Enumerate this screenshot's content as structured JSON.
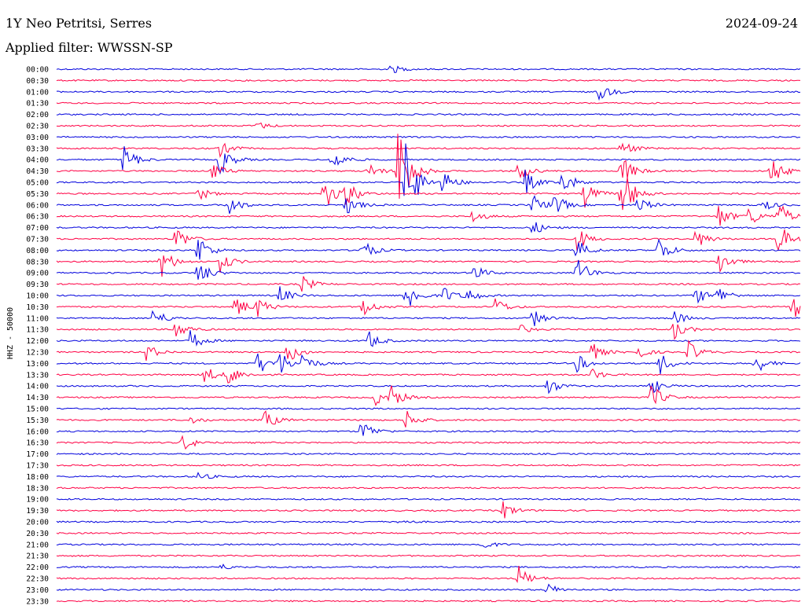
{
  "header": {
    "station": "1Y Neo Petritsi, Serres",
    "date": "2024-09-24",
    "filter": "Applied filter: WWSSN-SP"
  },
  "chart_data": {
    "type": "line",
    "ylabel": "HHZ - 50000",
    "colors": [
      "#0000dd",
      "#ff0044"
    ],
    "rows": [
      {
        "label": "00:00",
        "events": [
          {
            "t": 0.45,
            "a": 6
          }
        ]
      },
      {
        "label": "00:30",
        "events": []
      },
      {
        "label": "01:00",
        "events": [
          {
            "t": 0.73,
            "a": 12
          }
        ]
      },
      {
        "label": "01:30",
        "events": []
      },
      {
        "label": "02:00",
        "events": []
      },
      {
        "label": "02:30",
        "events": [
          {
            "t": 0.27,
            "a": 5
          }
        ]
      },
      {
        "label": "03:00",
        "events": []
      },
      {
        "label": "03:30",
        "events": [
          {
            "t": 0.22,
            "a": 10
          },
          {
            "t": 0.76,
            "a": 12
          }
        ]
      },
      {
        "label": "04:00",
        "events": [
          {
            "t": 0.09,
            "a": 22
          },
          {
            "t": 0.22,
            "a": 20
          },
          {
            "t": 0.37,
            "a": 18
          }
        ]
      },
      {
        "label": "04:30",
        "events": [
          {
            "t": 0.21,
            "a": 12
          },
          {
            "t": 0.42,
            "a": 10
          },
          {
            "t": 0.46,
            "a": 80
          },
          {
            "t": 0.62,
            "a": 14
          },
          {
            "t": 0.76,
            "a": 22
          },
          {
            "t": 0.96,
            "a": 22
          }
        ]
      },
      {
        "label": "05:00",
        "events": [
          {
            "t": 0.47,
            "a": 60
          },
          {
            "t": 0.52,
            "a": 18
          },
          {
            "t": 0.63,
            "a": 16
          },
          {
            "t": 0.68,
            "a": 18
          }
        ]
      },
      {
        "label": "05:30",
        "events": [
          {
            "t": 0.19,
            "a": 10
          },
          {
            "t": 0.36,
            "a": 22
          },
          {
            "t": 0.39,
            "a": 18
          },
          {
            "t": 0.71,
            "a": 18
          },
          {
            "t": 0.76,
            "a": 40
          }
        ]
      },
      {
        "label": "06:00",
        "events": [
          {
            "t": 0.23,
            "a": 16
          },
          {
            "t": 0.39,
            "a": 14
          },
          {
            "t": 0.64,
            "a": 14
          },
          {
            "t": 0.67,
            "a": 14
          },
          {
            "t": 0.78,
            "a": 14
          },
          {
            "t": 0.95,
            "a": 8
          }
        ]
      },
      {
        "label": "06:30",
        "events": [
          {
            "t": 0.56,
            "a": 10
          },
          {
            "t": 0.89,
            "a": 16
          },
          {
            "t": 0.93,
            "a": 14
          },
          {
            "t": 0.97,
            "a": 20
          }
        ]
      },
      {
        "label": "07:00",
        "events": [
          {
            "t": 0.64,
            "a": 10
          }
        ]
      },
      {
        "label": "07:30",
        "events": [
          {
            "t": 0.16,
            "a": 18
          },
          {
            "t": 0.7,
            "a": 16
          },
          {
            "t": 0.86,
            "a": 14
          },
          {
            "t": 0.97,
            "a": 24
          }
        ]
      },
      {
        "label": "08:00",
        "events": [
          {
            "t": 0.19,
            "a": 22
          },
          {
            "t": 0.41,
            "a": 16
          },
          {
            "t": 0.7,
            "a": 14
          },
          {
            "t": 0.81,
            "a": 18
          }
        ]
      },
      {
        "label": "08:30",
        "events": [
          {
            "t": 0.14,
            "a": 22
          },
          {
            "t": 0.22,
            "a": 14
          },
          {
            "t": 0.89,
            "a": 18
          }
        ]
      },
      {
        "label": "09:00",
        "events": [
          {
            "t": 0.19,
            "a": 20
          },
          {
            "t": 0.56,
            "a": 12
          },
          {
            "t": 0.7,
            "a": 22
          }
        ]
      },
      {
        "label": "09:30",
        "events": [
          {
            "t": 0.33,
            "a": 12
          }
        ]
      },
      {
        "label": "10:00",
        "events": [
          {
            "t": 0.3,
            "a": 12
          },
          {
            "t": 0.47,
            "a": 24
          },
          {
            "t": 0.52,
            "a": 12
          },
          {
            "t": 0.55,
            "a": 12
          },
          {
            "t": 0.86,
            "a": 12
          },
          {
            "t": 0.89,
            "a": 12
          }
        ]
      },
      {
        "label": "10:30",
        "events": [
          {
            "t": 0.24,
            "a": 16
          },
          {
            "t": 0.27,
            "a": 12
          },
          {
            "t": 0.41,
            "a": 16
          },
          {
            "t": 0.59,
            "a": 12
          },
          {
            "t": 0.99,
            "a": 16
          }
        ]
      },
      {
        "label": "11:00",
        "events": [
          {
            "t": 0.13,
            "a": 14
          },
          {
            "t": 0.64,
            "a": 12
          },
          {
            "t": 0.83,
            "a": 10
          }
        ]
      },
      {
        "label": "11:30",
        "events": [
          {
            "t": 0.16,
            "a": 14
          },
          {
            "t": 0.62,
            "a": 8
          },
          {
            "t": 0.83,
            "a": 14
          }
        ]
      },
      {
        "label": "12:00",
        "events": [
          {
            "t": 0.18,
            "a": 14
          },
          {
            "t": 0.42,
            "a": 12
          }
        ]
      },
      {
        "label": "12:30",
        "events": [
          {
            "t": 0.12,
            "a": 12
          },
          {
            "t": 0.31,
            "a": 16
          },
          {
            "t": 0.72,
            "a": 12
          },
          {
            "t": 0.78,
            "a": 10
          },
          {
            "t": 0.85,
            "a": 14
          }
        ]
      },
      {
        "label": "13:00",
        "events": [
          {
            "t": 0.27,
            "a": 16
          },
          {
            "t": 0.3,
            "a": 16
          },
          {
            "t": 0.33,
            "a": 14
          },
          {
            "t": 0.7,
            "a": 12
          },
          {
            "t": 0.81,
            "a": 16
          },
          {
            "t": 0.94,
            "a": 14
          }
        ]
      },
      {
        "label": "13:30",
        "events": [
          {
            "t": 0.2,
            "a": 12
          },
          {
            "t": 0.23,
            "a": 16
          },
          {
            "t": 0.72,
            "a": 8
          }
        ]
      },
      {
        "label": "14:00",
        "events": [
          {
            "t": 0.66,
            "a": 12
          },
          {
            "t": 0.8,
            "a": 10
          }
        ]
      },
      {
        "label": "14:30",
        "events": [
          {
            "t": 0.43,
            "a": 12
          },
          {
            "t": 0.45,
            "a": 14
          },
          {
            "t": 0.8,
            "a": 18
          }
        ]
      },
      {
        "label": "15:00",
        "events": []
      },
      {
        "label": "15:30",
        "events": [
          {
            "t": 0.18,
            "a": 5
          },
          {
            "t": 0.28,
            "a": 14
          },
          {
            "t": 0.47,
            "a": 14
          }
        ]
      },
      {
        "label": "16:00",
        "events": [
          {
            "t": 0.41,
            "a": 16
          }
        ]
      },
      {
        "label": "16:30",
        "events": [
          {
            "t": 0.17,
            "a": 12
          }
        ]
      },
      {
        "label": "17:00",
        "events": []
      },
      {
        "label": "17:30",
        "events": []
      },
      {
        "label": "18:00",
        "events": [
          {
            "t": 0.19,
            "a": 6
          }
        ]
      },
      {
        "label": "18:30",
        "events": []
      },
      {
        "label": "19:00",
        "events": []
      },
      {
        "label": "19:30",
        "events": [
          {
            "t": 0.6,
            "a": 12
          }
        ]
      },
      {
        "label": "20:00",
        "events": [
          {
            "t": 0.46,
            "a": 3
          }
        ]
      },
      {
        "label": "20:30",
        "events": []
      },
      {
        "label": "21:00",
        "events": [
          {
            "t": 0.57,
            "a": 8
          }
        ]
      },
      {
        "label": "21:30",
        "events": []
      },
      {
        "label": "22:00",
        "events": [
          {
            "t": 0.22,
            "a": 4
          }
        ]
      },
      {
        "label": "22:30",
        "events": [
          {
            "t": 0.62,
            "a": 18
          }
        ]
      },
      {
        "label": "23:00",
        "events": [
          {
            "t": 0.66,
            "a": 8
          }
        ]
      },
      {
        "label": "23:30",
        "events": []
      }
    ]
  }
}
